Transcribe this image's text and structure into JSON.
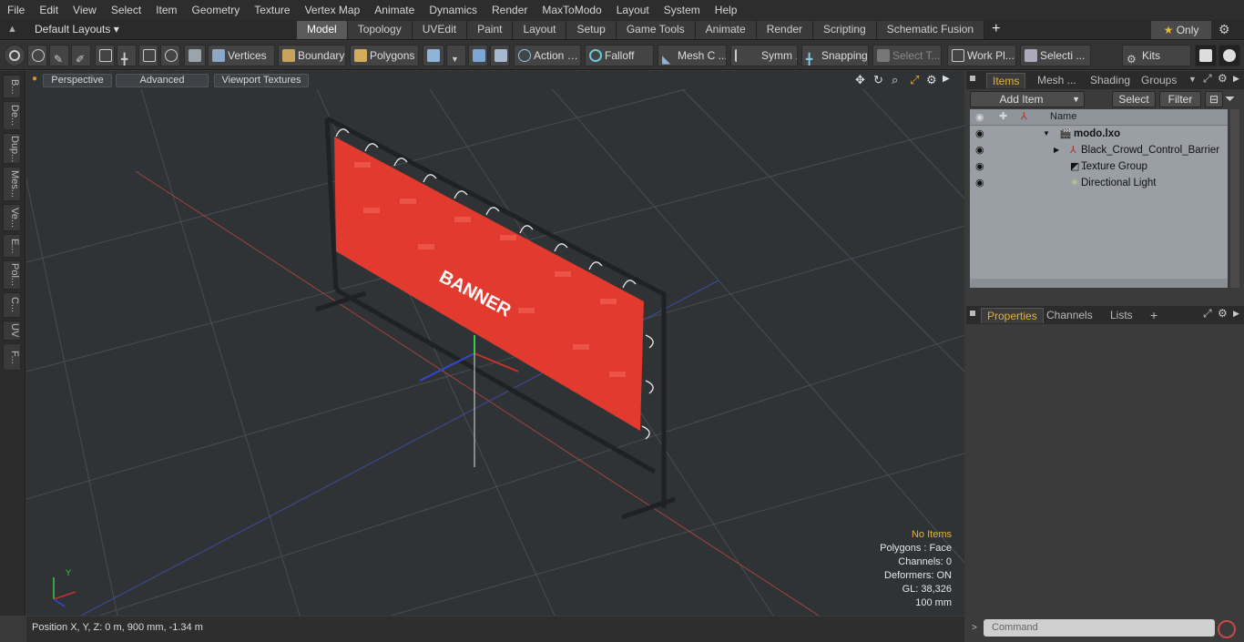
{
  "menu": [
    "File",
    "Edit",
    "View",
    "Select",
    "Item",
    "Geometry",
    "Texture",
    "Vertex Map",
    "Animate",
    "Dynamics",
    "Render",
    "MaxToModo",
    "Layout",
    "System",
    "Help"
  ],
  "layout": {
    "selector": "Default Layouts ▾",
    "tabs": [
      "Model",
      "Topology",
      "UVEdit",
      "Paint",
      "Layout",
      "Setup",
      "Game Tools",
      "Animate",
      "Render",
      "Scripting",
      "Schematic Fusion"
    ],
    "active_tab": "Model",
    "only_star": "★",
    "only_label": "Only"
  },
  "toolbar": {
    "vertices": "Vertices",
    "boundary": "Boundary",
    "polygons": "Polygons",
    "action": "Action",
    "falloff": "Falloff",
    "mesh": "Mesh C ...",
    "symm": "Symm ...",
    "snapping": "Snapping",
    "select_t": "Select T...",
    "work_pl": "Work Pl...",
    "selecti": "Selecti ...",
    "kits": "Kits"
  },
  "left_tabs": [
    "B...",
    "De...",
    "Dup...",
    "Mes...",
    "Ve...",
    "E...",
    "Pol...",
    "C...",
    "UV",
    "F..."
  ],
  "viewport": {
    "tabs": [
      "Perspective",
      "Advanced",
      "Viewport Textures"
    ],
    "banner_text": "BANNER",
    "axis_y": "Y",
    "hud": {
      "no_items": "No Items",
      "polygons": "Polygons : Face",
      "channels": "Channels: 0",
      "deformers": "Deformers: ON",
      "gl": "GL: 38,326",
      "scale": "100 mm"
    }
  },
  "status": {
    "position": "Position X, Y, Z:   0 m, 900 mm, -1.34 m"
  },
  "items_panel": {
    "tabs": [
      "Items",
      "Mesh ...",
      "Shading",
      "Groups"
    ],
    "add_item": "Add Item",
    "select": "Select",
    "filter": "Filter",
    "column_name": "Name",
    "rows": [
      {
        "label": "modo.lxo",
        "bold": true
      },
      {
        "label": "Black_Crowd_Control_Barrier ...",
        "bold": false
      },
      {
        "label": "Texture Group",
        "bold": false
      },
      {
        "label": "Directional Light",
        "bold": false
      }
    ]
  },
  "properties_panel": {
    "tabs": [
      "Properties",
      "Channels",
      "Lists"
    ],
    "plus": "+"
  },
  "command": {
    "placeholder": "Command"
  }
}
